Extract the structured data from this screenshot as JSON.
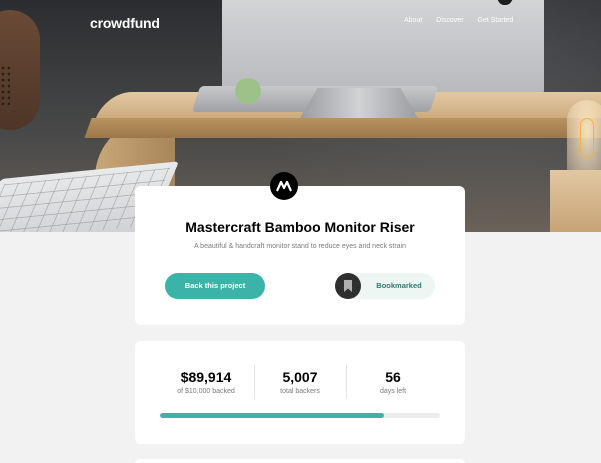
{
  "header": {
    "brand": "crowdfund",
    "nav": [
      "About",
      "Discover",
      "Get Started"
    ]
  },
  "project": {
    "title": "Mastercraft Bamboo Monitor Riser",
    "description": "A beautiful & handcraft monitor stand to reduce eyes and neck strain",
    "back_label": "Back this project",
    "bookmark_label": "Bookmarked",
    "logo_icon": "mastercraft-logo-icon"
  },
  "stats": {
    "backed_amount": "$89,914",
    "backed_caption": "of $10,000 backed",
    "backers_count": "5,007",
    "backers_caption": "total backers",
    "days_left": "56",
    "days_caption": "days left",
    "progress_fraction": 0.8
  },
  "colors": {
    "accent": "#3cb3a8",
    "accent_dark": "#2c7a70",
    "background": "#f2f2f2"
  }
}
